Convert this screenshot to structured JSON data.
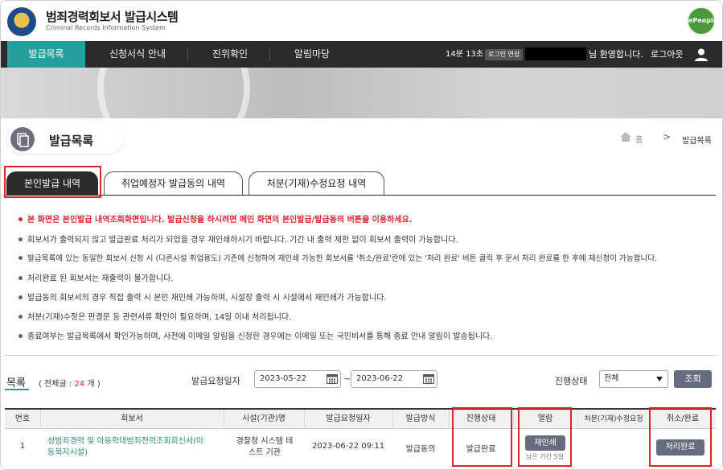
{
  "header": {
    "title": "범죄경력회보서 발급시스템",
    "subtitle": "Criminal Records Information System",
    "gov_badge": "ePeople"
  },
  "nav": {
    "items": [
      "발급목록",
      "신청서식 안내",
      "진위확인",
      "알림마당"
    ],
    "timer": "14분 13초",
    "extend_label": "로그인 연장",
    "welcome": "님 환영합니다.",
    "logout": "로그아웃"
  },
  "page": {
    "title": "발급목록",
    "breadcrumb_home": "홈",
    "breadcrumb_sep": ">",
    "breadcrumb_current": "발급목록"
  },
  "tabs": [
    "본인발급 내역",
    "취업예정자 발급동의 내역",
    "처분(기재)수정요청 내역"
  ],
  "notices": [
    "본 화면은 본인발급 내역조회화면입니다. 발급신청을 하시려면 메인 화면의 본인발급/발급동의 버튼을 이용하세요.",
    "회보서가 출력되지 않고 발급완료 처리가 되었을 경우 재인쇄하시기 바랍니다. 기간 내 출력 제한 없이 회보서 출력이 가능합니다.",
    "발급목록에 있는 동일한 회보서 신청 시 (다른시설 취업용도) 기존에 신청하여 재인쇄 가능한 회보서를 '취소/완료'란에 있는 '처리 완료' 버튼 클릭 후 문서 처리 완료를 한 후에 재신청이 가능합니다.",
    "처리완료 된 회보서는 재출력이 불가합니다.",
    "발급동의 회보서의 경우 직접 출력 시 본인 재인쇄 가능하며, 시설장 출력 시 시설에서 재인쇄가 가능합니다.",
    "처분(기재)수정은 판결문 등 관련서류 확인이 필요하며, 14일 이내 처리됩니다.",
    "종료여부는 발급목록에서 확인가능하며, 사전에 이메일 알림을 신청한 경우에는 이메일 또는 국민비서를 통해 종료 안내 알림이 발송됩니다."
  ],
  "filter": {
    "list_label": "목록",
    "total_prefix": "( 전체글 : ",
    "total_count": "24",
    "total_suffix": " 개 )",
    "date_label": "발급요청일자",
    "date_from": "2023-05-22",
    "date_tilde": "~",
    "date_to": "2023-06-22",
    "status_label": "진행상태",
    "status_value": "전체",
    "search_button": "조회"
  },
  "table": {
    "headers": [
      "번호",
      "회보서",
      "시설(기관)명",
      "발급요청일자",
      "발급방식",
      "진행상태",
      "열람",
      "처분(기재)수정요청",
      "취소/완료"
    ],
    "rows": [
      {
        "no": "1",
        "report_line1": "성범죄경력 및 아동학대범죄전력조회회신서(아",
        "report_line2": "동복지시설)",
        "facility_line1": "경찰청 시스템 테",
        "facility_line2": "스트 기관",
        "request_date": "2023-06-22 09:11",
        "method": "발급동의",
        "status": "발급완료",
        "view_button": "재인쇄",
        "remaining": "남은 기간 5일",
        "complete_button": "처리완료"
      }
    ]
  }
}
